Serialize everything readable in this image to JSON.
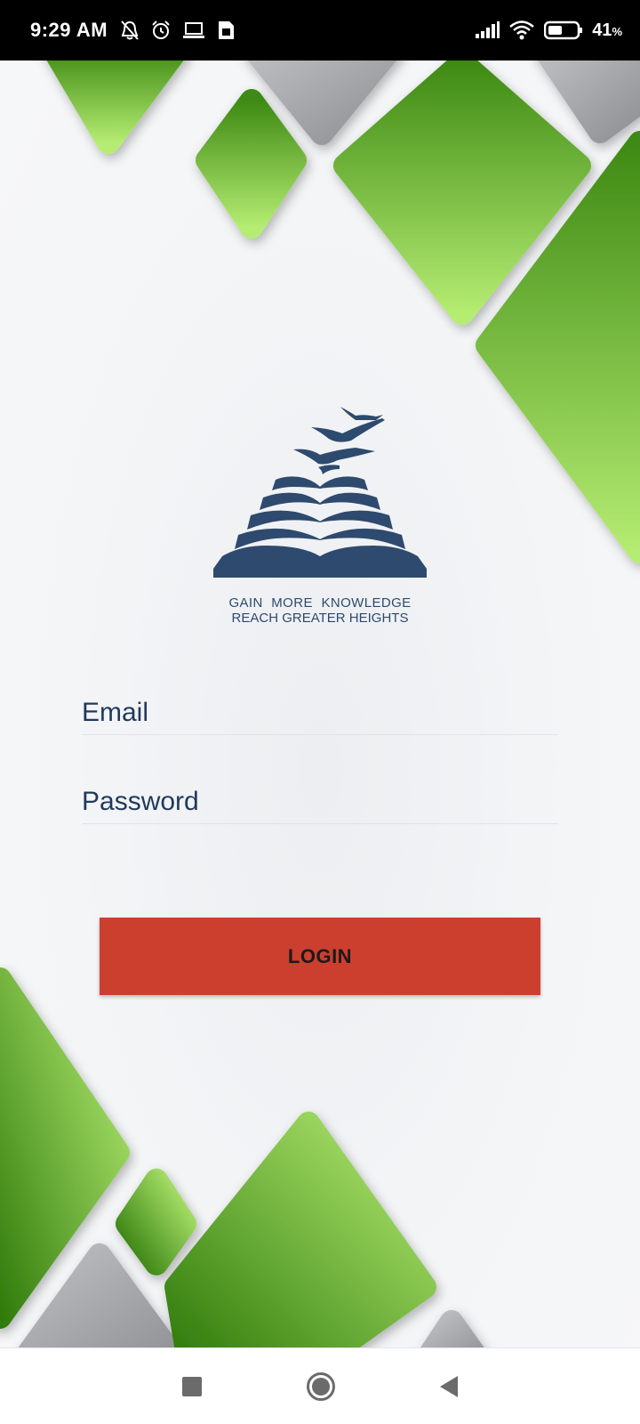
{
  "status_bar": {
    "time": "9:29 AM",
    "left_icons": [
      "muted-bell-icon",
      "alarm-clock-icon",
      "laptop-icon",
      "sim-card-icon"
    ],
    "right_icons": [
      "signal-bars-icon",
      "wifi-icon",
      "battery-icon"
    ],
    "battery_level": 41,
    "battery_text": "41",
    "battery_unit": "%"
  },
  "logo": {
    "tagline_line1": "GAIN MORE KNOWLEDGE",
    "tagline_line2": "REACH GREATER HEIGHTS",
    "color": "#2e4a6e"
  },
  "form": {
    "email_placeholder": "Email",
    "email_value": "",
    "password_placeholder": "Password",
    "password_value": "",
    "login_label": "LOGIN"
  },
  "colors": {
    "accent_button": "#cc3f2e",
    "green_light": "#b5ec72",
    "green_dark": "#2f7a0b",
    "gray_tile": "#9d9fa3"
  },
  "nav_bar": {
    "buttons": [
      "recent-apps-icon",
      "home-icon",
      "back-icon"
    ]
  }
}
